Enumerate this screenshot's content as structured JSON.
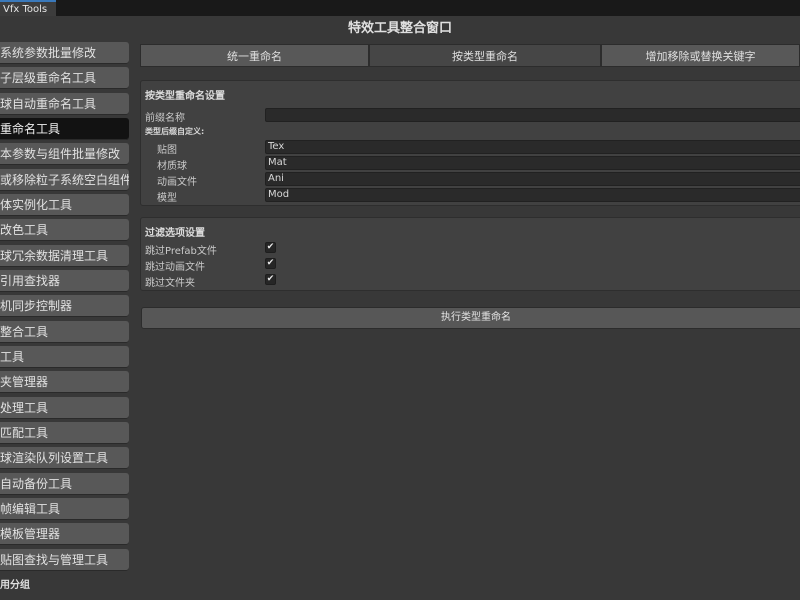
{
  "window_tab": {
    "label": "Vfx Tools"
  },
  "title": "特效工具整合窗口",
  "sidebar": {
    "items": [
      {
        "label": "系统参数批量修改"
      },
      {
        "label": "子层级重命名工具"
      },
      {
        "label": "球自动重命名工具"
      },
      {
        "label": "重命名工具"
      },
      {
        "label": "本参数与组件批量修改"
      },
      {
        "label": "或移除粒子系统空白组件"
      },
      {
        "label": "体实例化工具"
      },
      {
        "label": "改色工具"
      },
      {
        "label": "球冗余数据清理工具"
      },
      {
        "label": "引用查找器"
      },
      {
        "label": "机同步控制器"
      },
      {
        "label": "整合工具"
      },
      {
        "label": "工具"
      },
      {
        "label": "夹管理器"
      },
      {
        "label": "处理工具"
      },
      {
        "label": "匹配工具"
      },
      {
        "label": "球渲染队列设置工具"
      },
      {
        "label": "自动备份工具"
      },
      {
        "label": "帧编辑工具"
      },
      {
        "label": "模板管理器"
      },
      {
        "label": "贴图查找与管理工具"
      }
    ],
    "active_index": 3,
    "group_label": "用分组"
  },
  "top_tabs": [
    {
      "label": "统一重命名"
    },
    {
      "label": "按类型重命名"
    },
    {
      "label": "增加移除或替换关键字"
    }
  ],
  "active_top_tab": 1,
  "type_rename_settings": {
    "title": "按类型重命名设置",
    "prefix_label": "前缀名称",
    "prefix_value": "",
    "suffix_header": "类型后缀自定义:",
    "suffixes": [
      {
        "label": "贴图",
        "value": "Tex"
      },
      {
        "label": "材质球",
        "value": "Mat"
      },
      {
        "label": "动画文件",
        "value": "Ani"
      },
      {
        "label": "模型",
        "value": "Mod"
      }
    ]
  },
  "filter_settings": {
    "title": "过滤选项设置",
    "options": [
      {
        "label": "跳过Prefab文件",
        "checked": true
      },
      {
        "label": "跳过动画文件",
        "checked": true
      },
      {
        "label": "跳过文件夹",
        "checked": true
      }
    ]
  },
  "execute_button": "执行类型重命名",
  "check_glyph": "✔",
  "colors": {
    "background": "#383838",
    "sidebar_active": "#121212",
    "sidebar_item": "#585858",
    "field": "#2a2a2a",
    "tab_accent": "#3a79bb"
  }
}
